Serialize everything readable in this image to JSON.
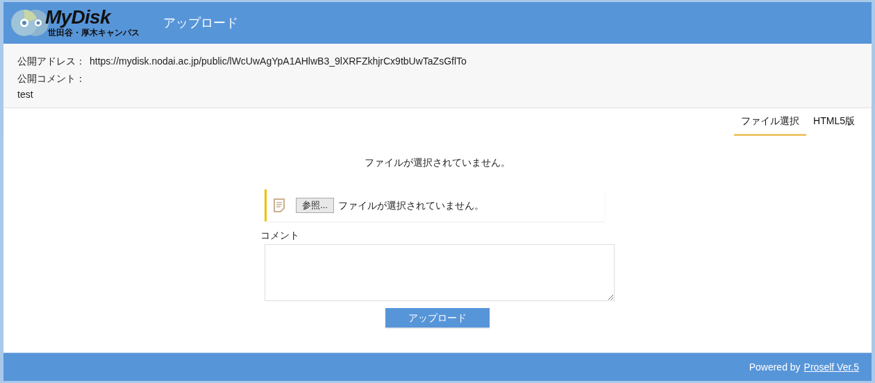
{
  "header": {
    "logo_title": "MyDisk",
    "logo_subtitle": "世田谷・厚木キャンパス",
    "title": "アップロード"
  },
  "info": {
    "address_label": "公開アドレス：",
    "address": "https://mydisk.nodai.ac.jp/public/lWcUwAgYpA1AHlwB3_9lXRFZkhjrCx9tbUwTaZsGflTo",
    "comment_label": "公開コメント：",
    "comment": "test"
  },
  "tabs": [
    {
      "label": "ファイル選択",
      "selected": true
    },
    {
      "label": "HTML5版",
      "selected": false
    }
  ],
  "status": "ファイルが選択されていません。",
  "file_input": {
    "button": "参照...",
    "value": "ファイルが選択されていません。"
  },
  "comment_field": {
    "label": "コメント"
  },
  "upload_button": "アップロード",
  "footer": {
    "text": "Powered by",
    "link": "Proself Ver.5"
  }
}
